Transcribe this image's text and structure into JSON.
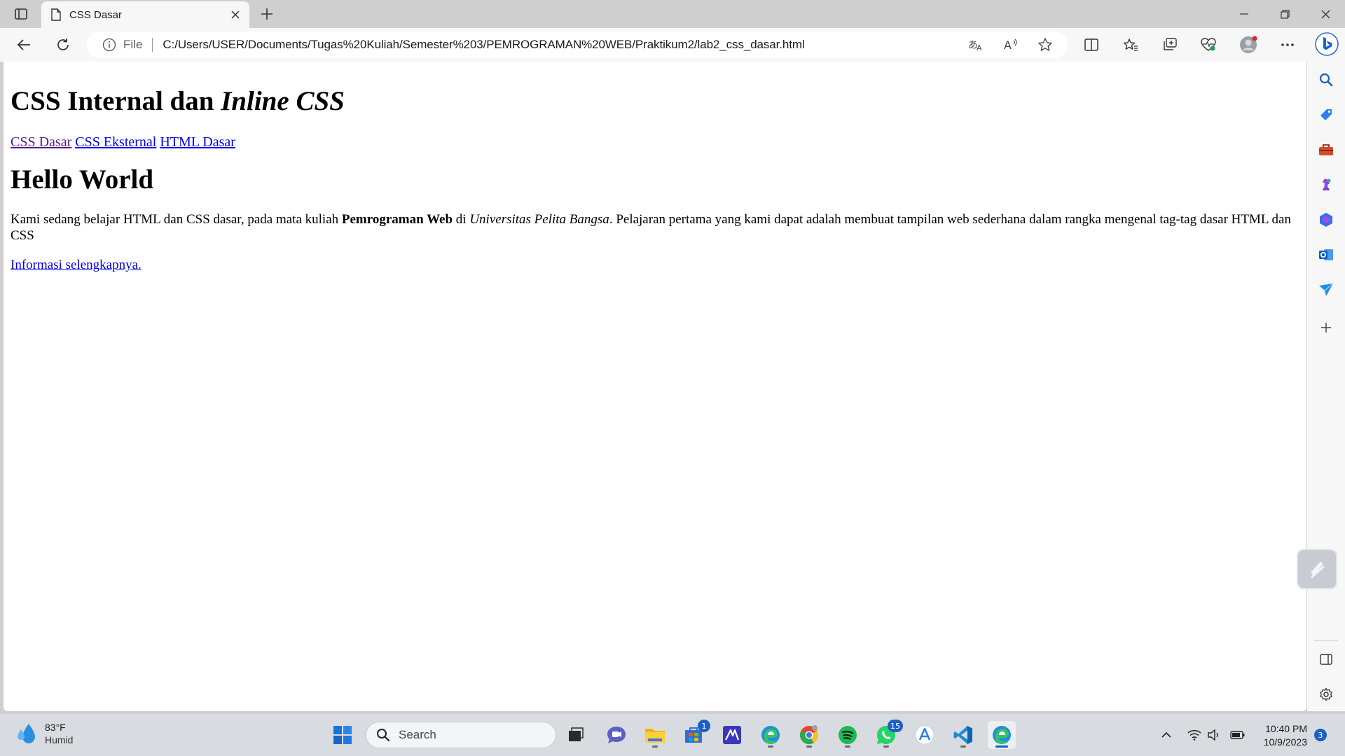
{
  "browser": {
    "tab": {
      "title": "CSS Dasar",
      "icon": "page-icon"
    },
    "address": {
      "scheme": "File",
      "url": "C:/Users/USER/Documents/Tugas%20Kuliah/Semester%203/PEMROGRAMAN%20WEB/Praktikum2/lab2_css_dasar.html"
    }
  },
  "page": {
    "title_plain": "CSS Internal dan ",
    "title_italic": "Inline CSS",
    "nav_links": [
      "CSS Dasar",
      "CSS Eksternal",
      "HTML Dasar"
    ],
    "heading": "Hello World",
    "paragraph": {
      "part1": "Kami sedang belajar HTML dan CSS dasar, pada mata kuliah ",
      "bold": "Pemrograman Web",
      "part2": " di ",
      "italic": "Universitas Pelita Bangsa",
      "part3": ". Pelajaran pertama yang kami dapat adalah membuat tampilan web sederhana dalam rangka mengenal tag-tag dasar HTML dan CSS"
    },
    "more_link": "Informasi selengkapnya."
  },
  "taskbar": {
    "weather": {
      "temp": "83°F",
      "condition": "Humid"
    },
    "search_placeholder": "Search",
    "badges": {
      "store": "1",
      "whatsapp": "15"
    },
    "clock": {
      "time": "10:40 PM",
      "date": "10/9/2023"
    },
    "notifications": "3"
  },
  "colors": {
    "link": "#0000ee",
    "visited_link": "#551a8b",
    "accent": "#0067c0"
  }
}
